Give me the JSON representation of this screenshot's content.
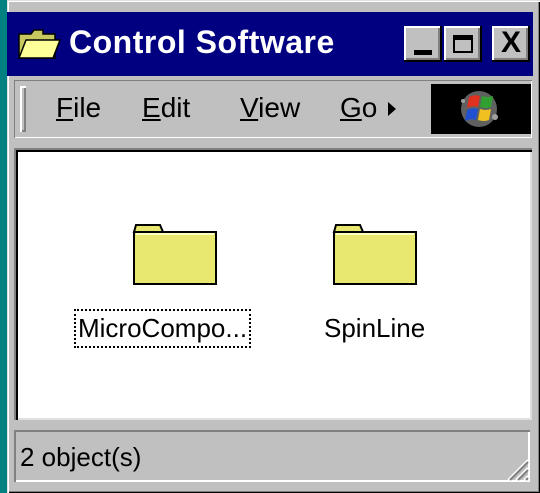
{
  "window": {
    "title": "Control Software",
    "icon": "open-folder-icon",
    "controls": {
      "minimize": "minimize-icon",
      "maximize": "maximize-icon",
      "close": "close-icon",
      "close_glyph": "X"
    }
  },
  "menubar": {
    "items": [
      {
        "underline": "F",
        "rest": "ile"
      },
      {
        "underline": "E",
        "rest": "dit"
      },
      {
        "underline": "V",
        "rest": "iew"
      },
      {
        "underline": "G",
        "rest": "o"
      }
    ],
    "overflow_icon": "chevron-right-icon",
    "logo_icon": "windows-logo-icon"
  },
  "content": {
    "items": [
      {
        "label": "MicroCompo...",
        "icon": "folder-icon",
        "focused": true
      },
      {
        "label": "SpinLine",
        "icon": "folder-icon",
        "focused": false
      }
    ]
  },
  "statusbar": {
    "text": "2 object(s)"
  },
  "colors": {
    "titlebar": "#000080",
    "face": "#c0c0c0",
    "folder": "#e8e870"
  }
}
